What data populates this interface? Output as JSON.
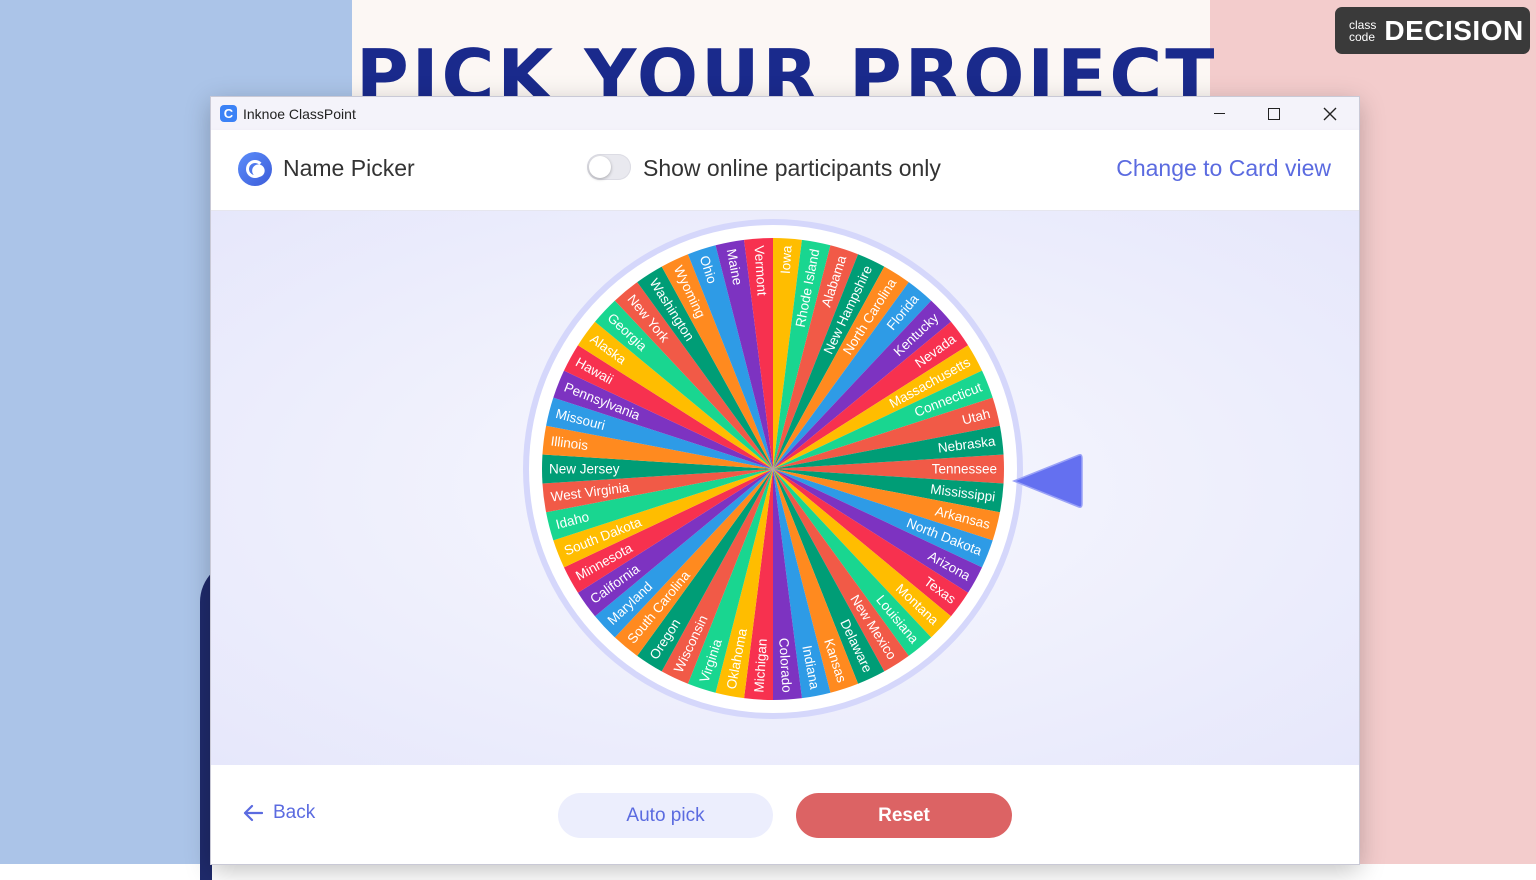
{
  "slide": {
    "title": "PICK YOUR PROJECT",
    "badge_small_1": "class",
    "badge_small_2": "code",
    "badge_code": "DECISION"
  },
  "window": {
    "app_title": "Inknoe ClassPoint",
    "app_icon": "classpoint-logo-icon",
    "controls": [
      "minimize",
      "maximize",
      "close"
    ]
  },
  "header": {
    "title": "Name Picker",
    "toggle_label": "Show online participants only",
    "toggle_on": false,
    "card_view_link": "Change to Card view"
  },
  "wheel": {
    "colors": [
      "#f15a47",
      "#009d76",
      "#ff8a1f",
      "#2e9be6",
      "#7d33c1",
      "#f7314f",
      "#ffbd00",
      "#19d690"
    ],
    "names": [
      "Tennessee",
      "Mississippi",
      "Arkansas",
      "North Dakota",
      "Arizona",
      "Texas",
      "Montana",
      "Louisiana",
      "New Mexico",
      "Delaware",
      "Kansas",
      "Indiana",
      "Colorado",
      "Michigan",
      "Oklahoma",
      "Virginia",
      "Wisconsin",
      "Oregon",
      "South Carolina",
      "Maryland",
      "California",
      "Minnesota",
      "South Dakota",
      "Idaho",
      "West Virginia",
      "New Jersey",
      "Illinois",
      "Missouri",
      "Pennsylvania",
      "Hawaii",
      "Alaska",
      "Georgia",
      "New York",
      "Washington",
      "Wyoming",
      "Ohio",
      "Maine",
      "Vermont",
      "Iowa",
      "Rhode Island",
      "Alabama",
      "New Hampshire",
      "North Carolina",
      "Florida",
      "Kentucky",
      "Nevada",
      "Massachusetts",
      "Connecticut",
      "Utah",
      "Nebraska"
    ],
    "pointer_color": "#6470f0"
  },
  "footer": {
    "back_label": "Back",
    "auto_pick_label": "Auto pick",
    "reset_label": "Reset"
  }
}
